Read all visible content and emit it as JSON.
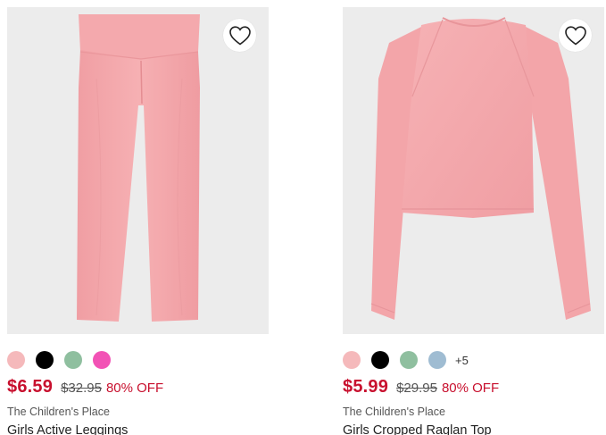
{
  "products": [
    {
      "image_alt": "pink leggings",
      "wishlist_icon": "heart-outline-icon",
      "swatches": [
        "#f5b9bb",
        "#000000",
        "#8fbf9f",
        "#f252b5"
      ],
      "more_colors": "",
      "price": "$6.59",
      "original_price": "$32.95",
      "discount": "80% OFF",
      "brand": "The Children's Place",
      "title": "Girls Active Leggings"
    },
    {
      "image_alt": "pink long sleeve cropped top",
      "wishlist_icon": "heart-outline-icon",
      "swatches": [
        "#f5b9bb",
        "#000000",
        "#8fbf9f",
        "#9fbcd2"
      ],
      "more_colors": "+5",
      "price": "$5.99",
      "original_price": "$29.95",
      "discount": "80% OFF",
      "brand": "The Children's Place",
      "title": "Girls Cropped Raglan Top"
    }
  ],
  "colors": {
    "sale_red": "#c8102e",
    "product_pink": "#f3a4a8",
    "image_bg": "#ececec"
  }
}
